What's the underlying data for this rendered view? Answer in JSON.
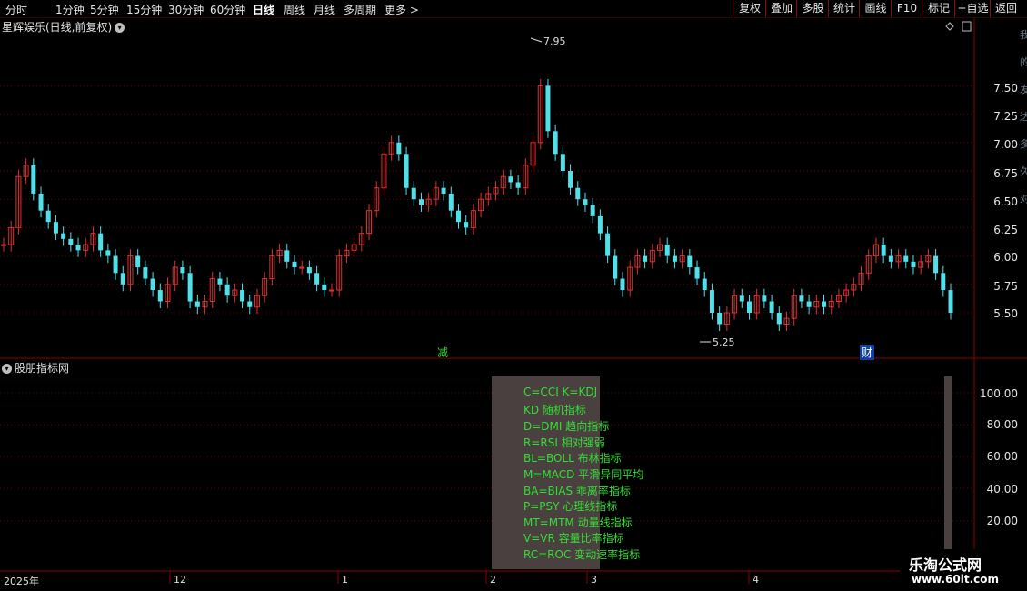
{
  "toolbar": {
    "periods": [
      "分时",
      "1分钟",
      "5分钟",
      "15分钟",
      "30分钟",
      "60分钟",
      "日线",
      "周线",
      "月线",
      "多周期",
      "更多"
    ],
    "active": "日线",
    "right_buttons": [
      "复权",
      "叠加",
      "多股",
      "统计",
      "画线",
      "F10",
      "标记",
      "+自选",
      "返回"
    ]
  },
  "chart": {
    "title": "星辉娱乐(日线,前复权)",
    "price_axis": [
      "7.50",
      "7.25",
      "7.00",
      "6.75",
      "6.50",
      "6.25",
      "6.00",
      "5.75",
      "5.50"
    ],
    "high_label": "7.95",
    "low_label": "5.25",
    "markers": [
      "减",
      "财"
    ],
    "colors": {
      "up": "#e03030",
      "down": "#4fe0ea",
      "grid": "#700000"
    }
  },
  "indicator": {
    "title": "股朋指标网",
    "axis": [
      "100.00",
      "80.00",
      "60.00",
      "40.00",
      "20.00"
    ],
    "popup_lines": [
      "C=CCI K=KDJ",
      "KD 随机指标",
      "D=DMI 趋向指标",
      "R=RSI 相对强弱",
      "BL=BOLL 布林指标",
      "M=MACD 平滑异同平均",
      "BA=BIAS 乖离率指标",
      "P=PSY 心理线指标",
      "MT=MTM 动量线指标",
      "V=VR 容量比率指标",
      "RC=ROC 变动速率指标"
    ]
  },
  "dates": [
    "2025年",
    "12",
    "1",
    "2",
    "3",
    "4"
  ],
  "watermark": {
    "name": "乐淘公式网",
    "url": "www.60lt.com"
  },
  "side_text": [
    "我",
    "的",
    "发",
    "达",
    "多",
    "久",
    "对"
  ]
}
